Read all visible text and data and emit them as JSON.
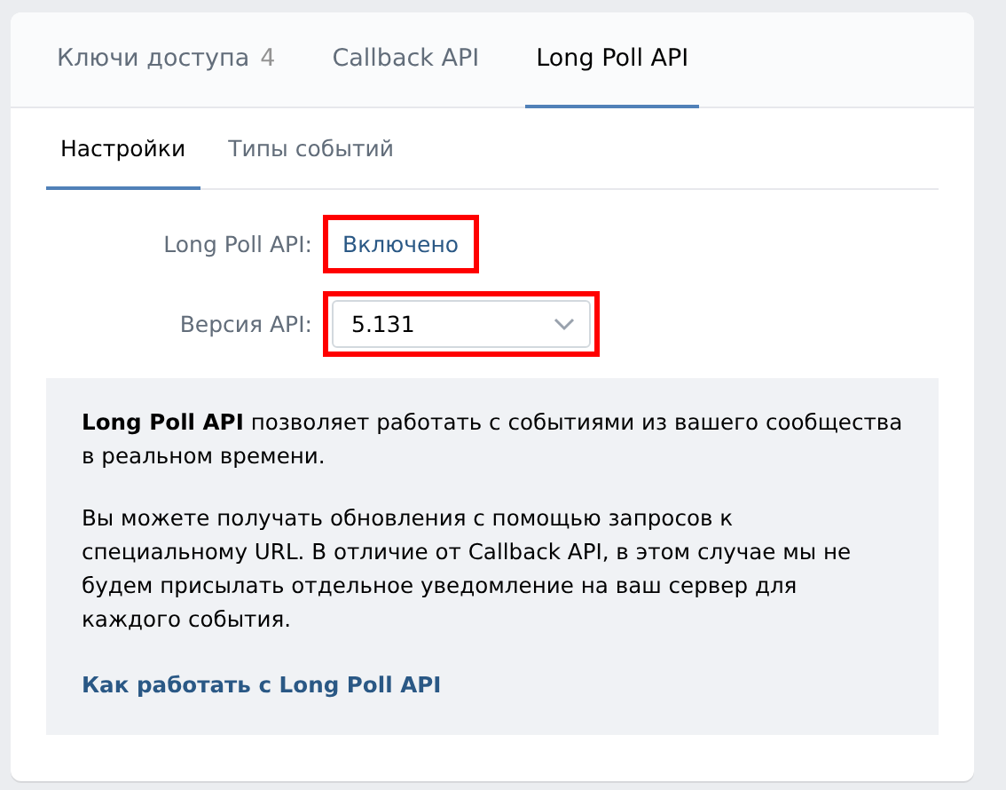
{
  "tabs": [
    {
      "label": "Ключи доступа",
      "count": "4",
      "selected": false
    },
    {
      "label": "Callback API",
      "selected": false
    },
    {
      "label": "Long Poll API",
      "selected": true
    }
  ],
  "subtabs": [
    {
      "label": "Настройки",
      "selected": true
    },
    {
      "label": "Типы событий",
      "selected": false
    }
  ],
  "settings": [
    {
      "kind": "text",
      "label": "Long Poll API:",
      "value": "Включено",
      "highlighted": true
    },
    {
      "kind": "select",
      "label": "Версия API:",
      "value": "5.131",
      "highlighted": true
    }
  ],
  "info": {
    "paragraphs": [
      "**Long Poll API** позволяет работать с событиями из вашего сообщества в реальном времени.",
      "Вы можете получать обновления с помощью запросов к специальному URL. В отличие от Callback API, в этом случае мы не будем присылать отдельное уведомление на ваш сервер для каждого события."
    ],
    "link": "Как работать с Long Poll API"
  }
}
